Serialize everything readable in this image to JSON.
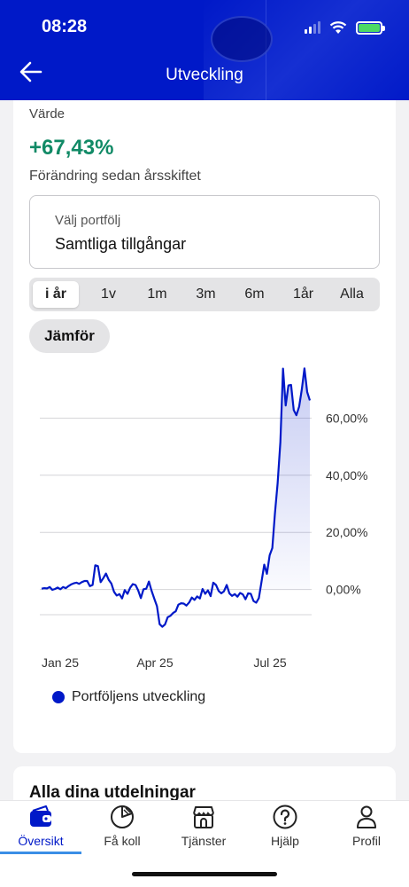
{
  "status": {
    "time": "08:28"
  },
  "header": {
    "title": "Utveckling"
  },
  "summary": {
    "label": "Värde",
    "value": "+67,43%",
    "subtitle": "Förändring sedan årsskiftet"
  },
  "portfolio_select": {
    "label": "Välj portfölj",
    "value": "Samtliga tillgångar"
  },
  "periods": [
    "i år",
    "1v",
    "1m",
    "3m",
    "6m",
    "1år",
    "Alla"
  ],
  "active_period": "i år",
  "compare_label": "Jämför",
  "colors": {
    "accent": "#0019c8",
    "positive": "#118a66"
  },
  "chart_data": {
    "type": "line",
    "x_tick_labels": [
      "Jan 25",
      "Apr 25",
      "Jul 25"
    ],
    "y_tick_labels": [
      "60,00%",
      "40,00%",
      "20,00%",
      "0,00%"
    ],
    "y_ticks": [
      60,
      40,
      20,
      0
    ],
    "ylim": [
      -15,
      75
    ],
    "y_axis_position": "right",
    "grid": true,
    "legend_position": "bottom-left",
    "series": [
      {
        "name": "Portföljens utveckling",
        "x": [
          0,
          3,
          6,
          9,
          12,
          15,
          18,
          21,
          24,
          27,
          30,
          33,
          36,
          39,
          42,
          45,
          48,
          51,
          54,
          57,
          60,
          63,
          66,
          69,
          72,
          75,
          78,
          81,
          84,
          87,
          90,
          93,
          96,
          99,
          102,
          105,
          108,
          111,
          114,
          117,
          120,
          123,
          126,
          129,
          132,
          135,
          138,
          141,
          144,
          147,
          150,
          153,
          156,
          159,
          162,
          165,
          168,
          171,
          174,
          177,
          180,
          183,
          186,
          189,
          192,
          195,
          198,
          201,
          204,
          207,
          210,
          213,
          216,
          219,
          222,
          225,
          228,
          231,
          234,
          237,
          240,
          243,
          246,
          249,
          252,
          255,
          258,
          261,
          264,
          267,
          270,
          273,
          276,
          279,
          282,
          285,
          288,
          291,
          294,
          297,
          300
        ],
        "values": [
          0.3,
          0.5,
          0.4,
          0.9,
          -0.1,
          0.2,
          0.7,
          0.1,
          0.9,
          0.5,
          1.2,
          1.8,
          2.2,
          2.4,
          2.0,
          2.6,
          3.0,
          3.0,
          1.2,
          1.6,
          8.5,
          8.2,
          2.6,
          4.0,
          5.6,
          3.4,
          2.1,
          -0.8,
          -2.1,
          -1.6,
          -3.1,
          -0.2,
          -1.5,
          0.6,
          1.9,
          1.6,
          -0.3,
          -3.0,
          0.1,
          0.3,
          2.8,
          -0.4,
          -3.2,
          -5.8,
          -12.1,
          -13.0,
          -12.2,
          -9.7,
          -9.2,
          -8.2,
          -7.6,
          -5.3,
          -4.8,
          -4.9,
          -5.6,
          -4.5,
          -2.8,
          -3.6,
          -2.4,
          -3.1,
          0.2,
          -1.5,
          -0.3,
          -2.3,
          2.4,
          1.6,
          -0.5,
          -1.3,
          -0.6,
          1.6,
          -1.3,
          -2.2,
          -1.6,
          -2.5,
          -1.2,
          -1.7,
          -3.4,
          -1.3,
          -1.5,
          -4.0,
          -4.6,
          -3.0,
          2.9,
          8.7,
          5.5,
          12.0,
          14.5,
          26.8,
          37.2,
          51.6,
          77.3,
          64.4,
          71.4,
          71.6,
          62.8,
          61.0,
          64.0,
          70.0,
          77.4,
          69.1,
          66.2
        ]
      }
    ]
  },
  "next_section_title": "Alla dina utdelningar",
  "tabs": [
    {
      "label": "Översikt",
      "icon": "wallet-icon",
      "active": true
    },
    {
      "label": "Få koll",
      "icon": "pie-chart-icon",
      "active": false
    },
    {
      "label": "Tjänster",
      "icon": "shop-icon",
      "active": false
    },
    {
      "label": "Hjälp",
      "icon": "help-icon",
      "active": false
    },
    {
      "label": "Profil",
      "icon": "profile-icon",
      "active": false
    }
  ]
}
